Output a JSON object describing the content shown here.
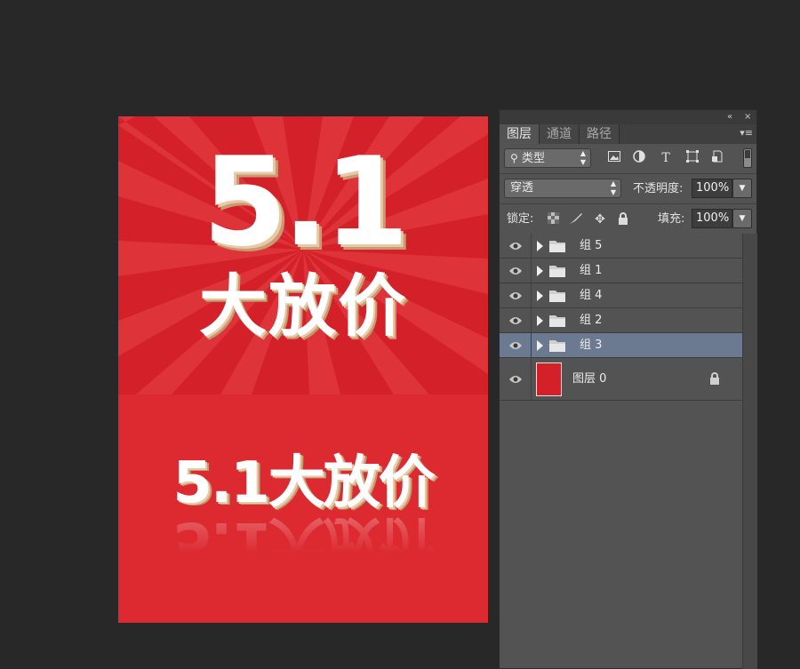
{
  "canvas": {
    "top_number": "5.1",
    "top_title": "大放价",
    "bottom_line": "5.1大放价",
    "background_color": "#da272e"
  },
  "panel": {
    "titlebar": {
      "collapse_icon": "«",
      "close_icon": "×"
    },
    "tabs": [
      {
        "label": "图层",
        "active": true
      },
      {
        "label": "通道",
        "active": false
      },
      {
        "label": "路径",
        "active": false
      }
    ],
    "menu_icon": "▾≡",
    "filter": {
      "kind_label": "类型",
      "icons": [
        "image-filter-icon",
        "adjustment-filter-icon",
        "type-filter-icon",
        "shape-filter-icon",
        "smart-object-filter-icon"
      ]
    },
    "blend": {
      "mode": "穿透",
      "opacity_label": "不透明度:",
      "opacity_value": "100%"
    },
    "lock": {
      "label": "锁定:",
      "fill_label": "填充:",
      "fill_value": "100%"
    },
    "layers": [
      {
        "name": "组 5",
        "type": "group",
        "visible": true,
        "selected": false
      },
      {
        "name": "组 1",
        "type": "group",
        "visible": true,
        "selected": false
      },
      {
        "name": "组 4",
        "type": "group",
        "visible": true,
        "selected": false
      },
      {
        "name": "组 2",
        "type": "group",
        "visible": true,
        "selected": false
      },
      {
        "name": "组 3",
        "type": "group",
        "visible": true,
        "selected": true
      },
      {
        "name": "图层 0",
        "type": "layer",
        "visible": true,
        "selected": false,
        "locked": true,
        "thumb_color": "#d42028"
      }
    ],
    "selected_color": "#6b7a91"
  }
}
